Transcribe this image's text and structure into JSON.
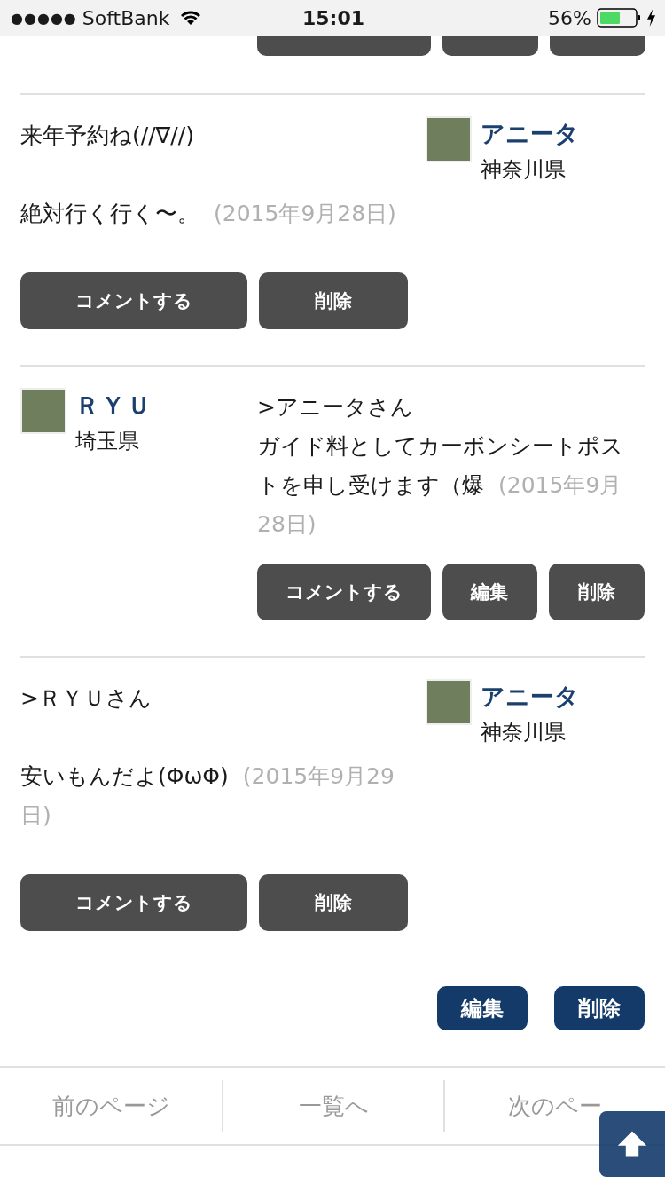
{
  "status_bar": {
    "signal": "●●●●●",
    "carrier": "SoftBank",
    "time": "15:01",
    "battery": "56%"
  },
  "comments": [
    {
      "kind": "own",
      "author": {
        "name": "アニータ",
        "location": "神奈川県"
      },
      "paragraphs": [
        "来年予約ね(//∇//)",
        "絶対行く行く〜。"
      ],
      "date": "(2015年9月28日)",
      "buttons": [
        "コメントする",
        "削除"
      ]
    },
    {
      "kind": "other",
      "author": {
        "name": "ＲＹＵ",
        "location": "埼玉県"
      },
      "paragraphs": [
        ">アニータさん",
        "ガイド料としてカーボンシートポストを申し受けます（爆"
      ],
      "date": "(2015年9月28日)",
      "buttons": [
        "コメントする",
        "編集",
        "削除"
      ]
    },
    {
      "kind": "own",
      "author": {
        "name": "アニータ",
        "location": "神奈川県"
      },
      "paragraphs": [
        ">ＲＹＵさん",
        "安いもんだよ(ΦωΦ)"
      ],
      "date": "(2015年9月29日)",
      "buttons": [
        "コメントする",
        "削除"
      ]
    }
  ],
  "post_actions": [
    "編集",
    "削除"
  ],
  "pager": [
    "前のページ",
    "一覧へ",
    "次のペー"
  ]
}
